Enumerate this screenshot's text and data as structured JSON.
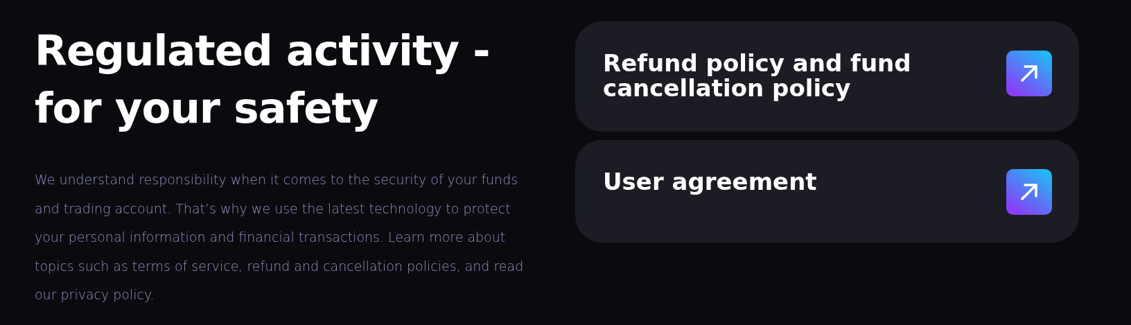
{
  "heading": "Regulated activity - for your safety",
  "description": "We understand responsibility when it comes to the security of your funds and trading account. That’s why we use the latest technology to protect your personal information and financial transactions. Learn more about topics such as terms of service, refund and cancellation policies, and read our privacy policy.",
  "links": [
    {
      "title": "Refund policy and fund cancellation policy"
    },
    {
      "title": "User agreement"
    }
  ]
}
